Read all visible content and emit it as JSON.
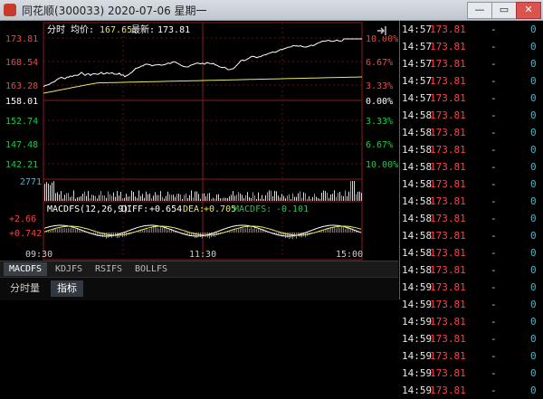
{
  "window": {
    "title": "同花顺(300033) 2020-07-06 星期一",
    "minimize_label": "—",
    "restore_label": "▭",
    "close_label": "✕"
  },
  "chart": {
    "header": {
      "mode": "分时",
      "avg_label": "均价:",
      "avg_value": "167.65",
      "last_label": "最新:",
      "last_value": "173.81"
    },
    "price_levels": [
      "173.81",
      "168.54",
      "163.28",
      "158.01",
      "152.74",
      "147.48",
      "142.21"
    ],
    "pct_levels": [
      "10.00%",
      "6.67%",
      "3.33%",
      "0.00%",
      "3.33%",
      "6.67%",
      "10.00%"
    ],
    "volume_level": "2771",
    "time_labels": [
      "09:30",
      "11:30",
      "15:00"
    ],
    "macd": {
      "header_name": "MACDFS",
      "header_params": "(12,26,9)",
      "diff_label": "DIFF:",
      "diff_value": "+0.654",
      "dea_label": "DEA:",
      "dea_value": "+0.705",
      "macd_label": "MACDFS:",
      "macd_value": "-0.101",
      "scale_top": "+2.66",
      "scale_mid": "+0.742"
    },
    "colors": {
      "up": "#ff4040",
      "down": "#22c84a",
      "price_line": "#ffffff",
      "avg_line": "#e8e85a",
      "grid": "#8b1a1a",
      "volume": "#e8e85a",
      "dea": "#e8e85a",
      "macd_label": "#22c84a"
    }
  },
  "indicator_tabs": [
    "MACDFS",
    "KDJFS",
    "RSIFS",
    "BOLLFS"
  ],
  "bottom_tabs": [
    "分时量",
    "指标"
  ],
  "ticks": [
    {
      "time": "14:57",
      "price": "173.81",
      "vol": "-",
      "dir": "0"
    },
    {
      "time": "14:57",
      "price": "173.81",
      "vol": "-",
      "dir": "0"
    },
    {
      "time": "14:57",
      "price": "173.81",
      "vol": "-",
      "dir": "0"
    },
    {
      "time": "14:57",
      "price": "173.81",
      "vol": "-",
      "dir": "0"
    },
    {
      "time": "14:57",
      "price": "173.81",
      "vol": "-",
      "dir": "0"
    },
    {
      "time": "14:58",
      "price": "173.81",
      "vol": "-",
      "dir": "0"
    },
    {
      "time": "14:58",
      "price": "173.81",
      "vol": "-",
      "dir": "0"
    },
    {
      "time": "14:58",
      "price": "173.81",
      "vol": "-",
      "dir": "0"
    },
    {
      "time": "14:58",
      "price": "173.81",
      "vol": "-",
      "dir": "0"
    },
    {
      "time": "14:58",
      "price": "173.81",
      "vol": "-",
      "dir": "0"
    },
    {
      "time": "14:58",
      "price": "173.81",
      "vol": "-",
      "dir": "0"
    },
    {
      "time": "14:58",
      "price": "173.81",
      "vol": "-",
      "dir": "0"
    },
    {
      "time": "14:58",
      "price": "173.81",
      "vol": "-",
      "dir": "0"
    },
    {
      "time": "14:58",
      "price": "173.81",
      "vol": "-",
      "dir": "0"
    },
    {
      "time": "14:58",
      "price": "173.81",
      "vol": "-",
      "dir": "0"
    },
    {
      "time": "14:59",
      "price": "173.81",
      "vol": "-",
      "dir": "0"
    },
    {
      "time": "14:59",
      "price": "173.81",
      "vol": "-",
      "dir": "0"
    },
    {
      "time": "14:59",
      "price": "173.81",
      "vol": "-",
      "dir": "0"
    },
    {
      "time": "14:59",
      "price": "173.81",
      "vol": "-",
      "dir": "0"
    },
    {
      "time": "14:59",
      "price": "173.81",
      "vol": "-",
      "dir": "0"
    },
    {
      "time": "14:59",
      "price": "173.81",
      "vol": "-",
      "dir": "0"
    },
    {
      "time": "14:59",
      "price": "173.81",
      "vol": "-",
      "dir": "0"
    }
  ]
}
